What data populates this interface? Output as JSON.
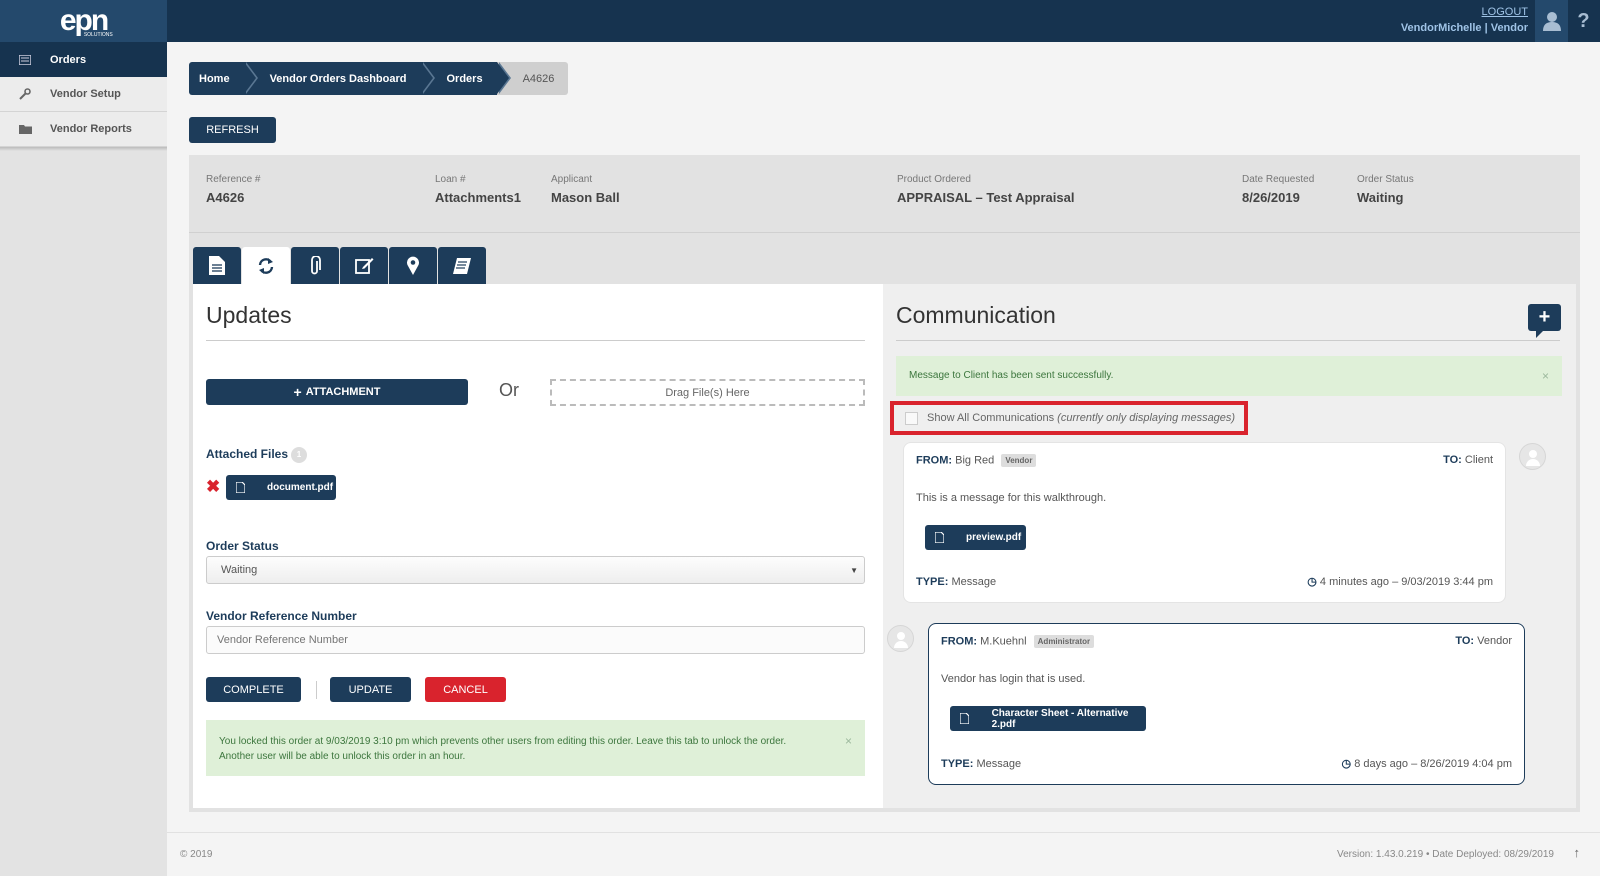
{
  "app": {
    "logo_text": "epn",
    "logo_sub": "SOLUTIONS",
    "logout_label": "LOGOUT",
    "user_display": "VendorMichelle | Vendor",
    "help_glyph": "?"
  },
  "sidebar": {
    "items": [
      {
        "label": "Orders",
        "icon": "list-icon"
      },
      {
        "label": "Vendor Setup",
        "icon": "wrench-icon"
      },
      {
        "label": "Vendor Reports",
        "icon": "folder-icon"
      }
    ]
  },
  "breadcrumb": [
    "Home",
    "Vendor Orders Dashboard",
    "Orders",
    "A4626"
  ],
  "toolbar": {
    "refresh_label": "REFRESH"
  },
  "order": {
    "reference_label": "Reference #",
    "reference": "A4626",
    "loan_label": "Loan #",
    "loan": "Attachments1",
    "applicant_label": "Applicant",
    "applicant": "Mason Ball",
    "product_label": "Product Ordered",
    "product": "APPRAISAL – Test Appraisal",
    "date_label": "Date Requested",
    "date": "8/26/2019",
    "status_label": "Order Status",
    "status": "Waiting"
  },
  "tabs": [
    {
      "icon": "document-icon",
      "glyph": "🗎"
    },
    {
      "icon": "refresh-icon",
      "glyph": "⟳"
    },
    {
      "icon": "paperclip-icon",
      "glyph": "⎘"
    },
    {
      "icon": "edit-icon",
      "glyph": "✎"
    },
    {
      "icon": "map-marker-icon",
      "glyph": "⌖"
    },
    {
      "icon": "book-icon",
      "glyph": "▰"
    }
  ],
  "updates": {
    "title": "Updates",
    "attachment_label": "ATTACHMENT",
    "attachment_plus": "+",
    "or_label": "Or",
    "dropzone_label": "Drag File(s) Here",
    "attached_files_label": "Attached Files",
    "attached_count": "1",
    "remove_glyph": "✖",
    "file_name": "document.pdf",
    "order_status_label": "Order Status",
    "order_status_value": "Waiting",
    "select_arrow": "▼",
    "vendor_ref_label": "Vendor Reference Number",
    "vendor_ref_placeholder": "Vendor Reference Number",
    "complete_label": "COMPLETE",
    "update_label": "UPDATE",
    "cancel_label": "CANCEL",
    "lock_notice_line1": "You locked this order at 9/03/2019 3:10 pm which prevents other users from editing this order. Leave this tab to unlock the order.",
    "lock_notice_line2": "Another user will be able to unlock this order in an hour.",
    "close_glyph": "×"
  },
  "communication": {
    "title": "Communication",
    "add_glyph": "+",
    "success_message": "Message to Client has been sent successfully.",
    "close_glyph": "×",
    "show_all_label": "Show All Communications",
    "show_all_note": "(currently only displaying messages)",
    "messages": [
      {
        "from_label": "FROM:",
        "from": "Big Red",
        "role": "Vendor",
        "to_label": "TO:",
        "to": "Client",
        "body": "This is a message for this walkthrough.",
        "attachment": "preview.pdf",
        "type_label": "TYPE:",
        "type": "Message",
        "time": "4 minutes ago – 9/03/2019 3:44 pm",
        "clock_glyph": "◷"
      },
      {
        "from_label": "FROM:",
        "from": "M.Kuehnl",
        "role": "Administrator",
        "to_label": "TO:",
        "to": "Vendor",
        "body": "Vendor has login that is used.",
        "attachment": "Character Sheet - Alternative 2.pdf",
        "type_label": "TYPE:",
        "type": "Message",
        "time": "8 days ago – 8/26/2019 4:04 pm",
        "clock_glyph": "◷"
      }
    ]
  },
  "footer": {
    "copyright": "© 2019",
    "version": "Version: 1.43.0.219  •  Date Deployed: 08/29/2019",
    "scroll_glyph": "↑"
  },
  "colors": {
    "navy": "#1d3c5a",
    "topbar": "#16334f",
    "danger": "#d9232d",
    "success_bg": "#dff0d8"
  }
}
